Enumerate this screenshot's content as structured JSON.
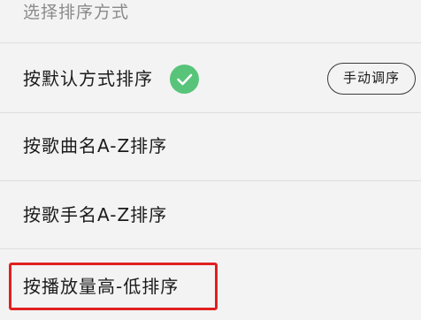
{
  "header": {
    "title": "选择排序方式"
  },
  "options": [
    {
      "label": "按默认方式排序",
      "selected": true
    },
    {
      "label": "按歌曲名A-Z排序",
      "selected": false
    },
    {
      "label": "按歌手名A-Z排序",
      "selected": false
    },
    {
      "label": "按播放量高-低排序",
      "selected": false
    }
  ],
  "manual_sort_button": {
    "label": "手动调序"
  },
  "icons": {
    "selected_indicator": "check-circle-icon"
  },
  "colors": {
    "check_green": "#58c47a",
    "highlight_red": "#e02020",
    "muted_text": "#8a8a8a"
  }
}
